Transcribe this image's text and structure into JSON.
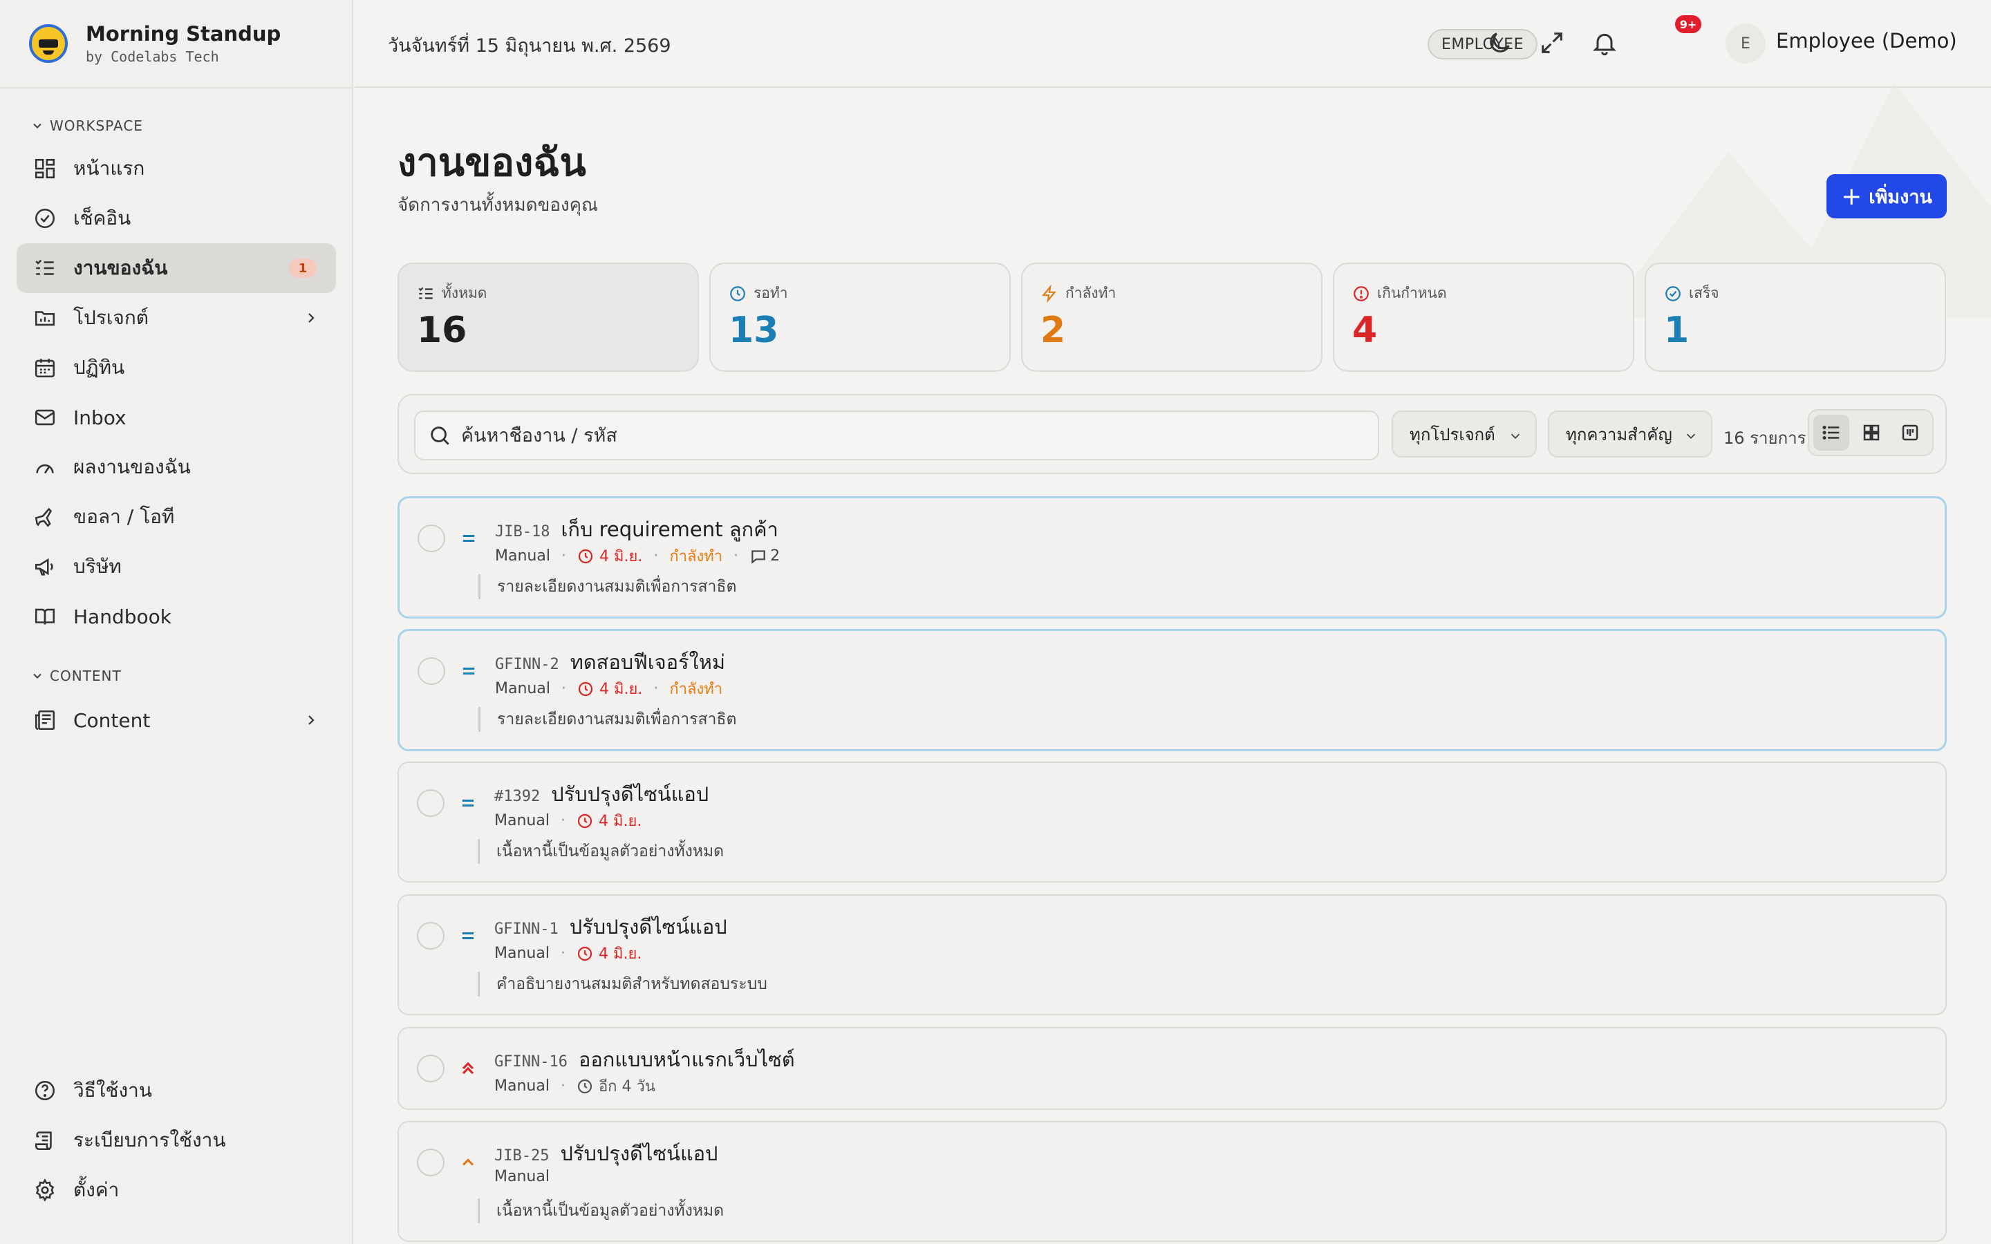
{
  "brand": {
    "name": "Morning Standup",
    "sub": "by Codelabs Tech"
  },
  "sidebar": {
    "workspace_label": "WORKSPACE",
    "content_label": "CONTENT",
    "items": [
      {
        "label": "หน้าแรก",
        "icon": "dashboard-icon"
      },
      {
        "label": "เช็คอิน",
        "icon": "check-circle-icon"
      },
      {
        "label": "งานของฉัน",
        "icon": "task-list-icon",
        "badge": "1",
        "active": true
      },
      {
        "label": "โปรเจกต์",
        "icon": "folder-chart-icon",
        "has_arrow": true
      },
      {
        "label": "ปฏิทิน",
        "icon": "calendar-icon"
      },
      {
        "label": "Inbox",
        "icon": "mail-icon"
      },
      {
        "label": "ผลงานของฉัน",
        "icon": "gauge-icon"
      },
      {
        "label": "ขอลา / โอที",
        "icon": "plane-icon"
      },
      {
        "label": "บริษัท",
        "icon": "megaphone-icon"
      },
      {
        "label": "Handbook",
        "icon": "book-icon"
      }
    ],
    "content_items": [
      {
        "label": "Content",
        "icon": "newspaper-icon",
        "has_arrow": true
      }
    ],
    "footer_items": [
      {
        "label": "วิธีใช้งาน",
        "icon": "help-icon"
      },
      {
        "label": "ระเบียบการใช้งาน",
        "icon": "scroll-icon"
      },
      {
        "label": "ตั้งค่า",
        "icon": "gear-icon"
      }
    ]
  },
  "topbar": {
    "date": "วันจันทร์ที่ 15 มิถุนายน พ.ศ. 2569",
    "role": "EMPLOYEE",
    "notif_count": "9+",
    "avatar_initial": "E",
    "user_name": "Employee (Demo)"
  },
  "main": {
    "title": "งานของฉัน",
    "subtitle": "จัดการงานทั้งหมดของคุณ",
    "add_button": "เพิ่มงาน",
    "stats": [
      {
        "label": "ทั้งหมด",
        "value": "16",
        "color": "#1f1f1f",
        "icon": "list-icon"
      },
      {
        "label": "รอทำ",
        "value": "13",
        "color": "#1a7fb5",
        "icon": "clock-icon"
      },
      {
        "label": "กำลังทำ",
        "value": "2",
        "color": "#e07b14",
        "icon": "bolt-icon"
      },
      {
        "label": "เกินกำหนด",
        "value": "4",
        "color": "#dc2626",
        "icon": "alert-icon"
      },
      {
        "label": "เสร็จ",
        "value": "1",
        "color": "#1a7fb5",
        "icon": "check-circle-icon"
      }
    ],
    "search_placeholder": "ค้นหาชื่องาน / รหัส",
    "project_filter": "ทุกโปรเจกต์",
    "priority_filter": "ทุกความสำคัญ",
    "count_text": "16 รายการ"
  },
  "tasks": [
    {
      "code": "JIB-18",
      "title": "เก็บ requirement ลูกค้า",
      "source": "Manual",
      "due": "4 มิ.ย.",
      "status": "กำลังทำ",
      "comments": "2",
      "desc": "รายละเอียดงานสมมติเพื่อการสาธิต",
      "priority": "medium"
    },
    {
      "code": "GFINN-2",
      "title": "ทดสอบฟีเจอร์ใหม่",
      "source": "Manual",
      "due": "4 มิ.ย.",
      "status": "กำลังทำ",
      "desc": "รายละเอียดงานสมมติเพื่อการสาธิต",
      "priority": "medium"
    },
    {
      "code": "#1392",
      "title": "ปรับปรุงดีไซน์แอป",
      "source": "Manual",
      "due": "4 มิ.ย.",
      "desc": "เนื้อหานี้เป็นข้อมูลตัวอย่างทั้งหมด",
      "priority": "medium"
    },
    {
      "code": "GFINN-1",
      "title": "ปรับปรุงดีไซน์แอป",
      "source": "Manual",
      "due": "4 มิ.ย.",
      "desc": "คำอธิบายงานสมมติสำหรับทดสอบระบบ",
      "priority": "medium"
    },
    {
      "code": "GFINN-16",
      "title": "ออกแบบหน้าแรกเว็บไซต์",
      "source": "Manual",
      "due": "อีก 4 วัน",
      "priority": "urgent"
    },
    {
      "code": "JIB-25",
      "title": "ปรับปรุงดีไซน์แอป",
      "source": "Manual",
      "desc": "เนื้อหานี้เป็นข้อมูลตัวอย่างทั้งหมด",
      "priority": "high"
    }
  ]
}
